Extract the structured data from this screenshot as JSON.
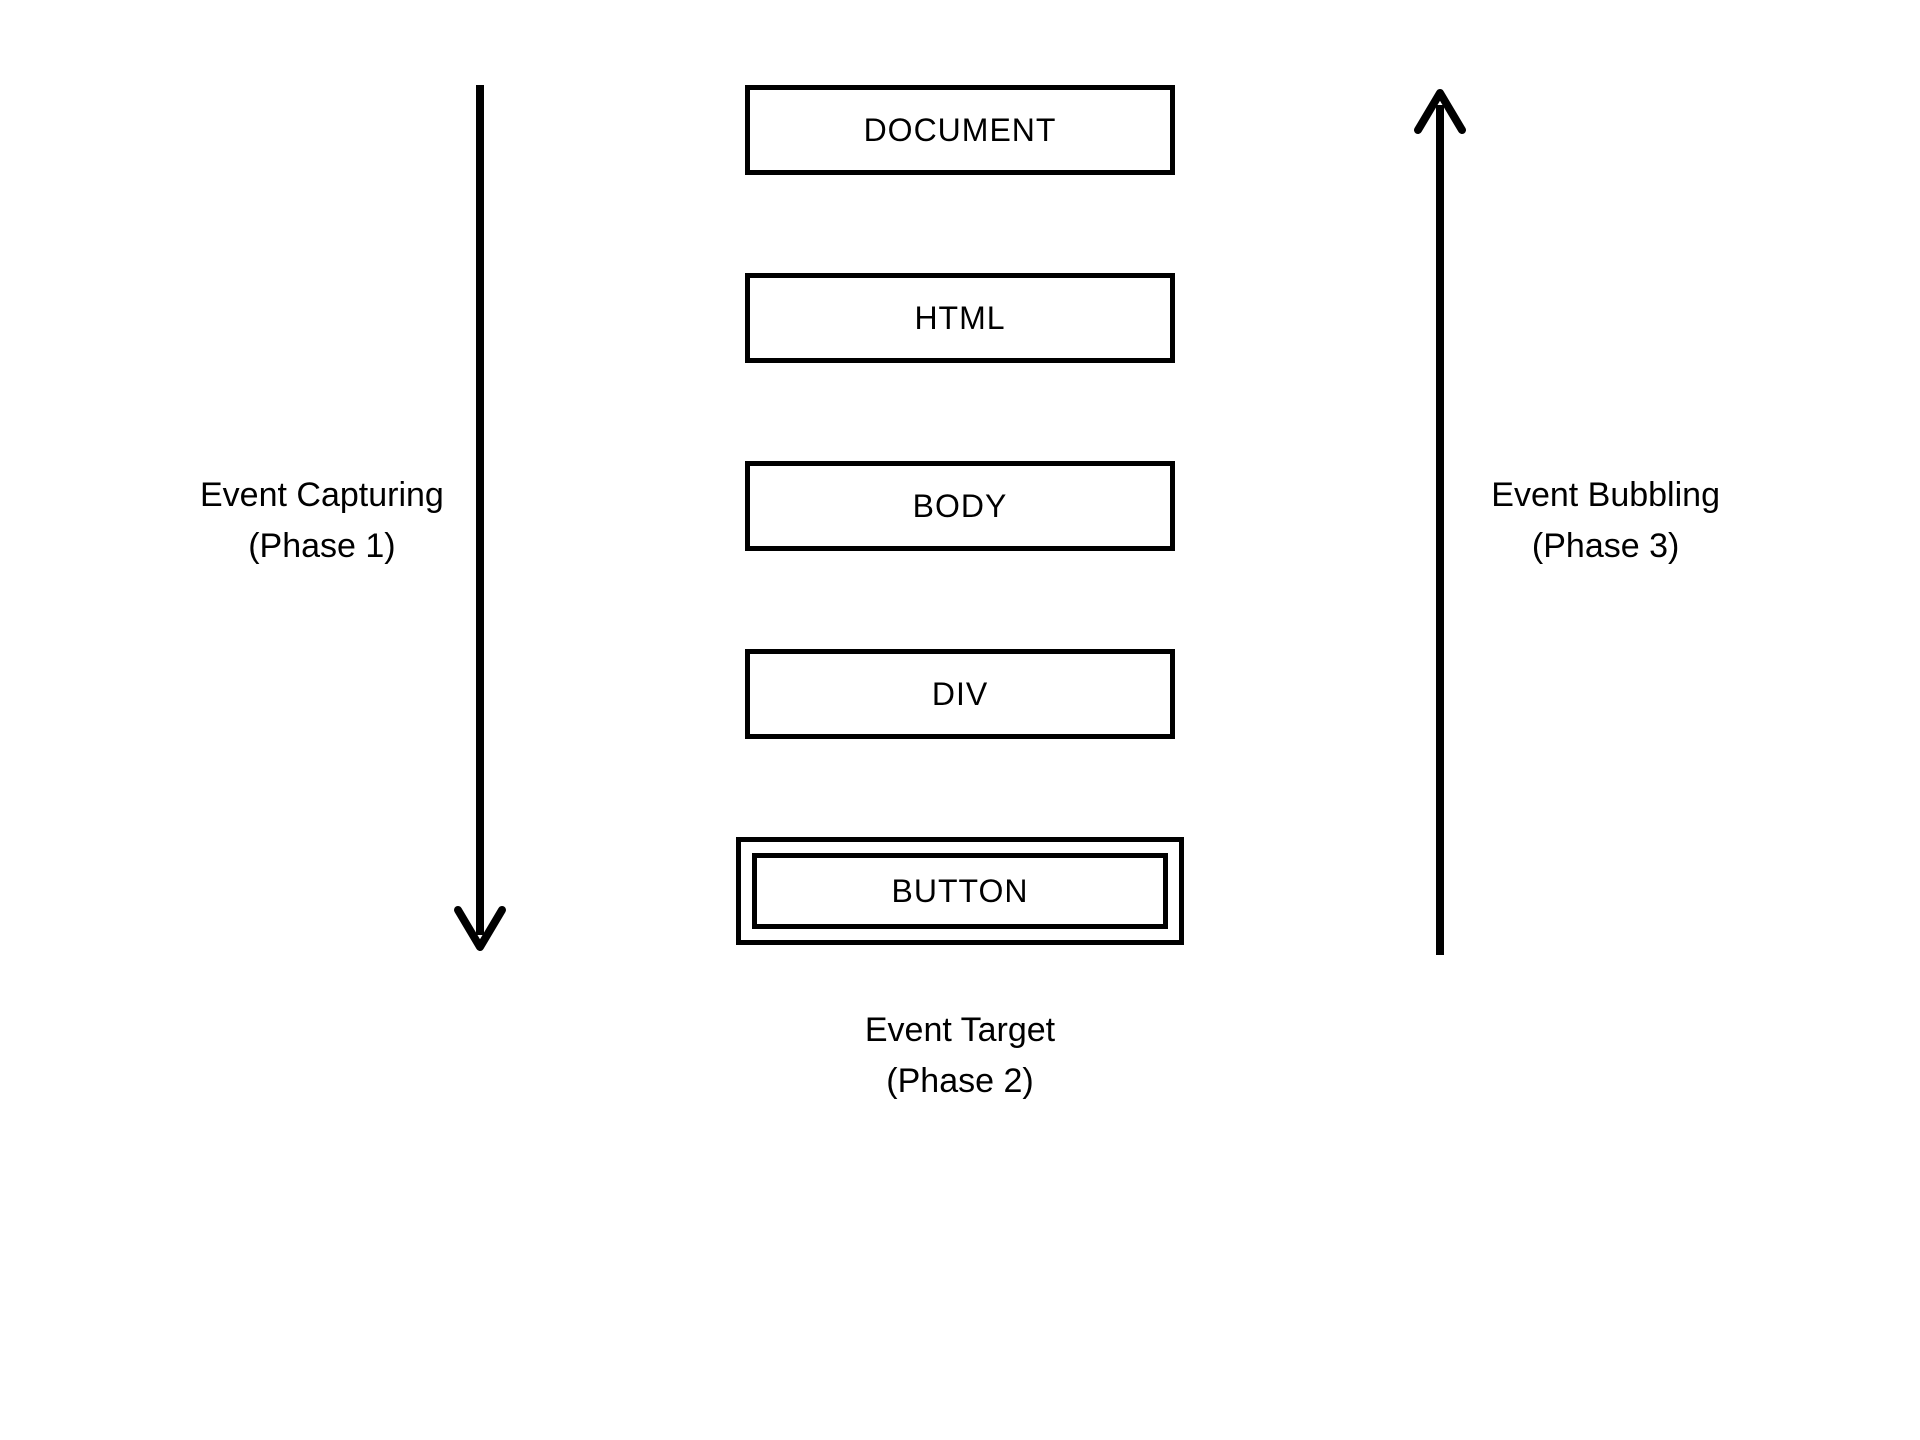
{
  "boxes": {
    "document": "DOCUMENT",
    "html": "HTML",
    "body": "BODY",
    "div": "DIV",
    "button": "BUTTON"
  },
  "labels": {
    "capturing_title": "Event Capturing",
    "capturing_sub": "(Phase 1)",
    "bubbling_title": "Event Bubbling",
    "bubbling_sub": "(Phase 3)",
    "target_title": "Event Target",
    "target_sub": "(Phase 2)"
  },
  "arrows": {
    "stroke": "#000000",
    "stroke_width": 8
  }
}
